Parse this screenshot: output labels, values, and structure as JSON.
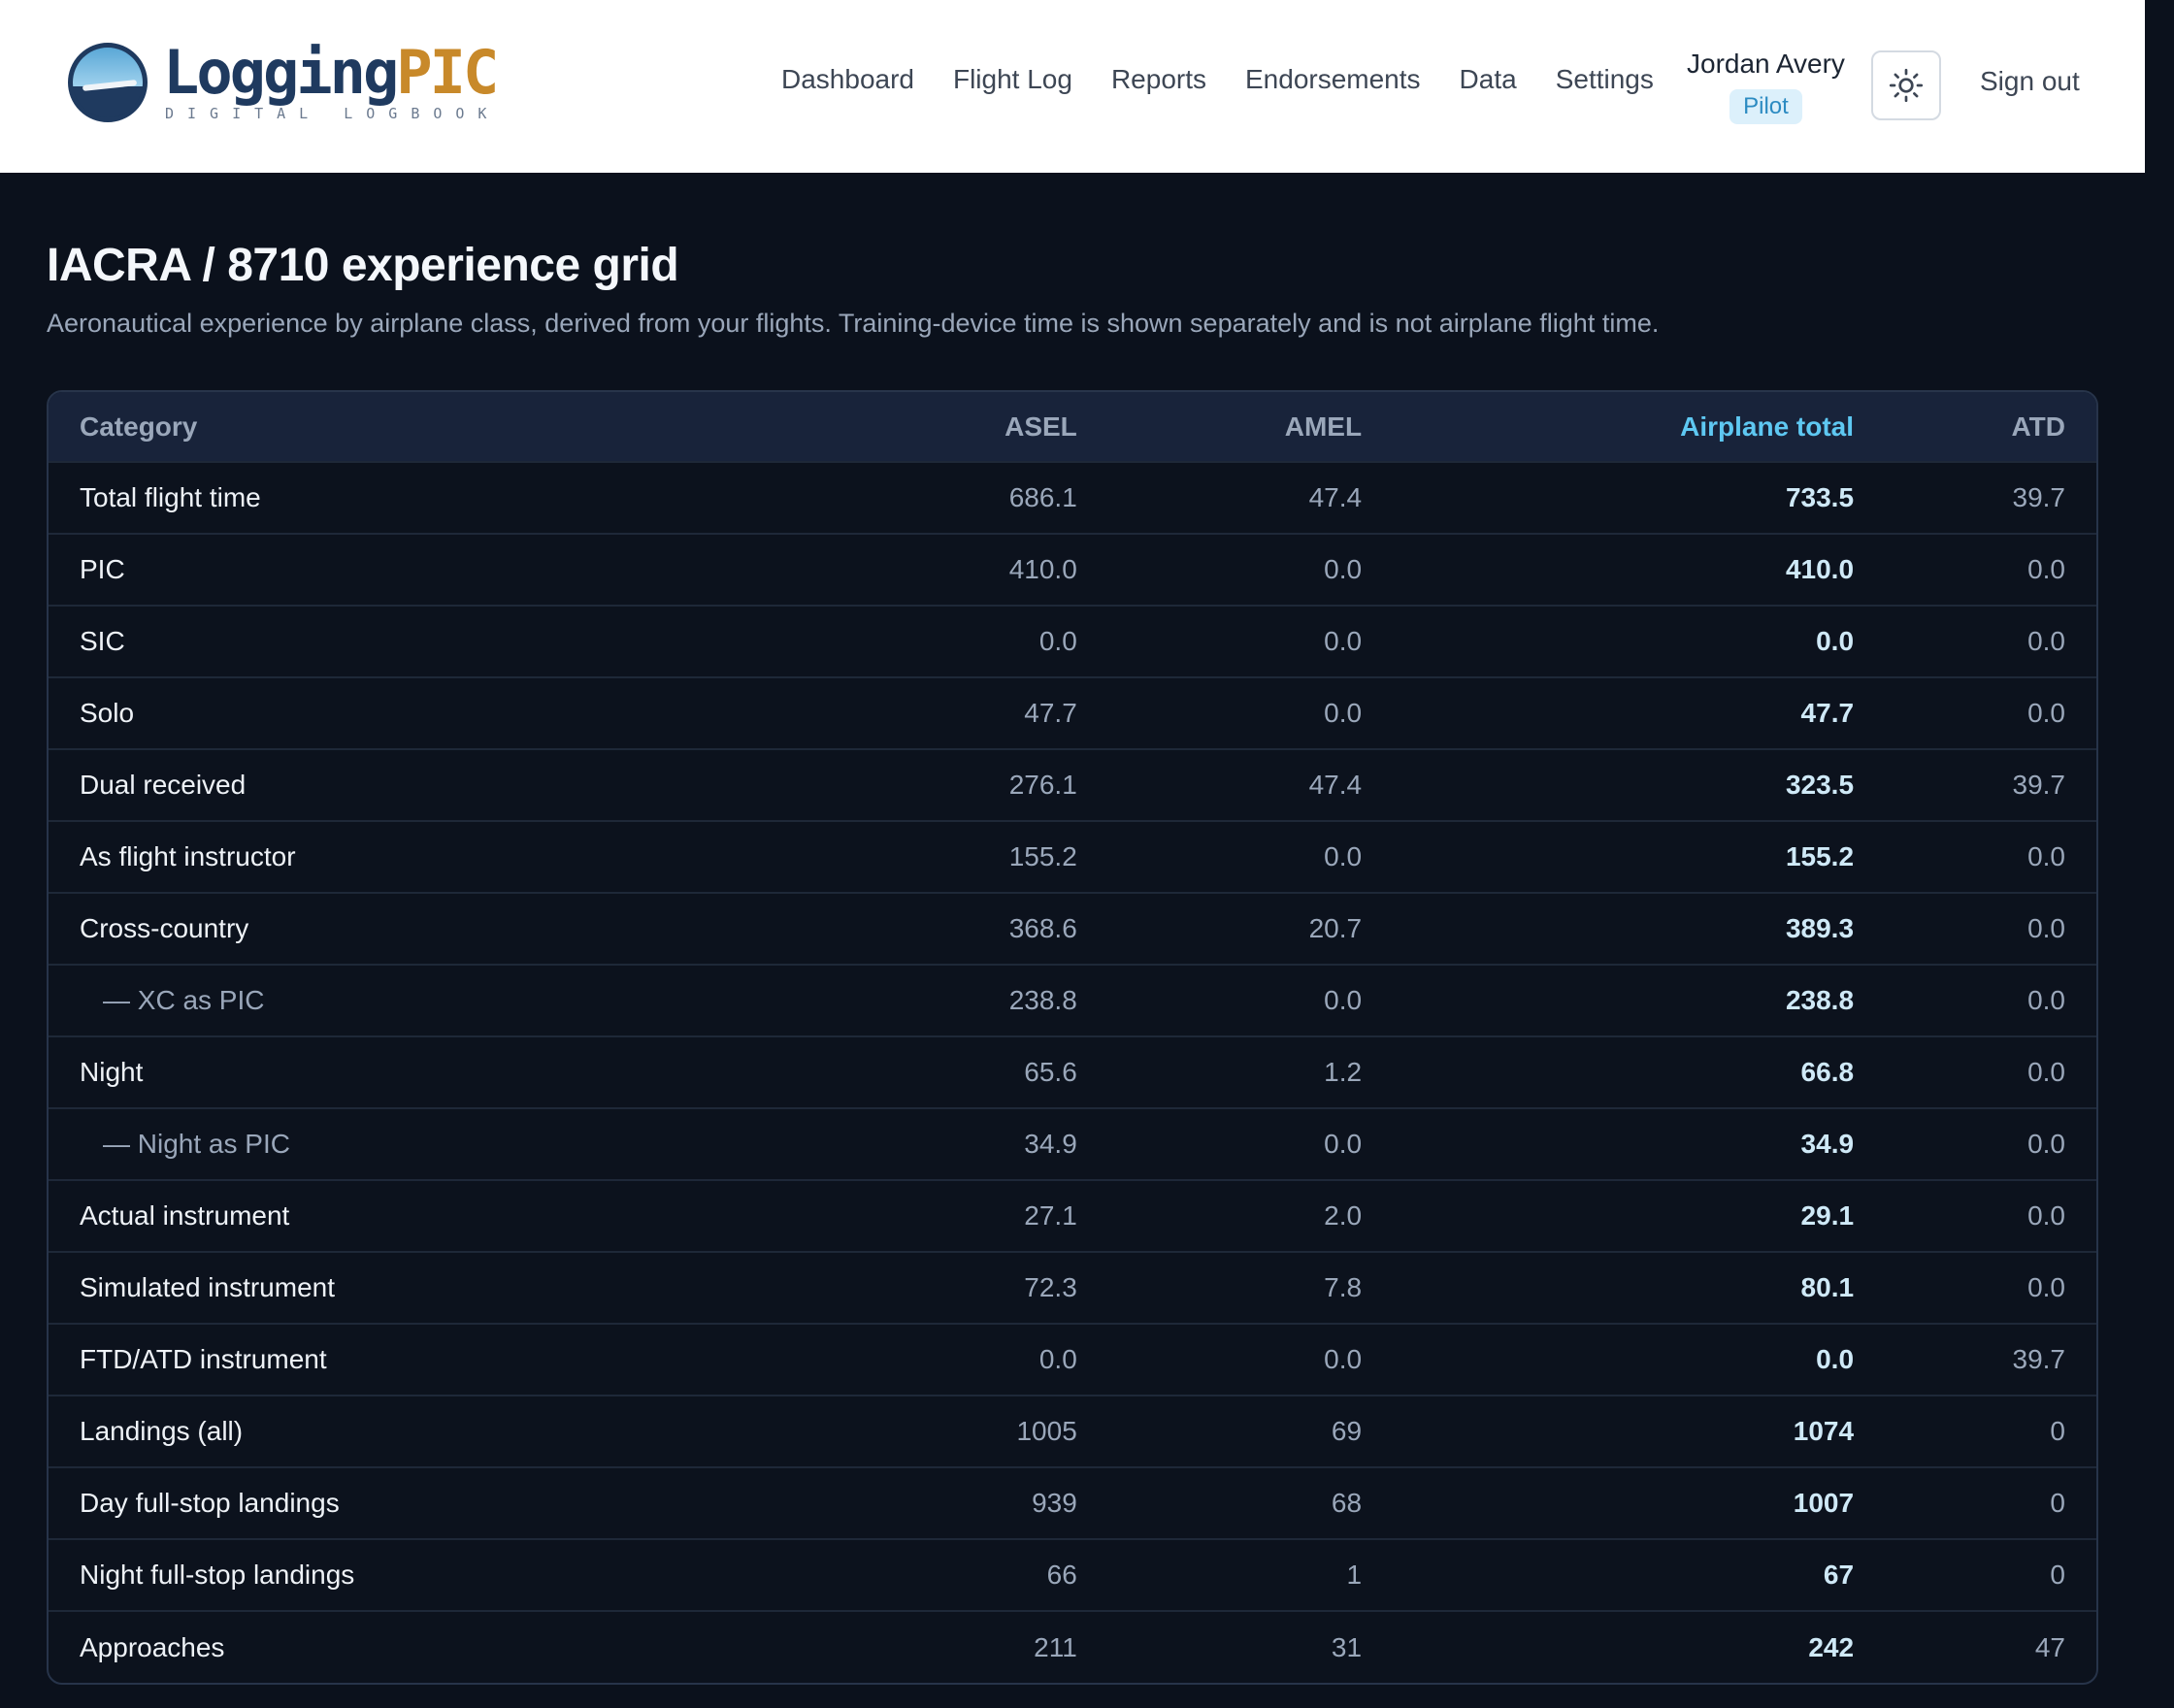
{
  "header": {
    "logo_primary": "Logging",
    "logo_accent": "PIC",
    "logo_tagline": "DIGITAL LOGBOOK",
    "nav": [
      "Dashboard",
      "Flight Log",
      "Reports",
      "Endorsements",
      "Data",
      "Settings"
    ],
    "user_name": "Jordan Avery",
    "user_role": "Pilot",
    "theme_icon": "sun-icon",
    "sign_out": "Sign out"
  },
  "page": {
    "title": "IACRA / 8710 experience grid",
    "subtitle": "Aeronautical experience by airplane class, derived from your flights. Training-device time is shown separately and is not airplane flight time."
  },
  "table": {
    "columns": [
      "Category",
      "ASEL",
      "AMEL",
      "Airplane total",
      "ATD"
    ],
    "rows": [
      {
        "category": "Total flight time",
        "sub": false,
        "asel": "686.1",
        "amel": "47.4",
        "total": "733.5",
        "atd": "39.7"
      },
      {
        "category": "PIC",
        "sub": false,
        "asel": "410.0",
        "amel": "0.0",
        "total": "410.0",
        "atd": "0.0"
      },
      {
        "category": "SIC",
        "sub": false,
        "asel": "0.0",
        "amel": "0.0",
        "total": "0.0",
        "atd": "0.0"
      },
      {
        "category": "Solo",
        "sub": false,
        "asel": "47.7",
        "amel": "0.0",
        "total": "47.7",
        "atd": "0.0"
      },
      {
        "category": "Dual received",
        "sub": false,
        "asel": "276.1",
        "amel": "47.4",
        "total": "323.5",
        "atd": "39.7"
      },
      {
        "category": "As flight instructor",
        "sub": false,
        "asel": "155.2",
        "amel": "0.0",
        "total": "155.2",
        "atd": "0.0"
      },
      {
        "category": "Cross-country",
        "sub": false,
        "asel": "368.6",
        "amel": "20.7",
        "total": "389.3",
        "atd": "0.0"
      },
      {
        "category": "— XC as PIC",
        "sub": true,
        "asel": "238.8",
        "amel": "0.0",
        "total": "238.8",
        "atd": "0.0"
      },
      {
        "category": "Night",
        "sub": false,
        "asel": "65.6",
        "amel": "1.2",
        "total": "66.8",
        "atd": "0.0"
      },
      {
        "category": "— Night as PIC",
        "sub": true,
        "asel": "34.9",
        "amel": "0.0",
        "total": "34.9",
        "atd": "0.0"
      },
      {
        "category": "Actual instrument",
        "sub": false,
        "asel": "27.1",
        "amel": "2.0",
        "total": "29.1",
        "atd": "0.0"
      },
      {
        "category": "Simulated instrument",
        "sub": false,
        "asel": "72.3",
        "amel": "7.8",
        "total": "80.1",
        "atd": "0.0"
      },
      {
        "category": "FTD/ATD instrument",
        "sub": false,
        "asel": "0.0",
        "amel": "0.0",
        "total": "0.0",
        "atd": "39.7"
      },
      {
        "category": "Landings (all)",
        "sub": false,
        "asel": "1005",
        "amel": "69",
        "total": "1074",
        "atd": "0"
      },
      {
        "category": "Day full-stop landings",
        "sub": false,
        "asel": "939",
        "amel": "68",
        "total": "1007",
        "atd": "0"
      },
      {
        "category": "Night full-stop landings",
        "sub": false,
        "asel": "66",
        "amel": "1",
        "total": "67",
        "atd": "0"
      },
      {
        "category": "Approaches",
        "sub": false,
        "asel": "211",
        "amel": "31",
        "total": "242",
        "atd": "47"
      }
    ]
  },
  "colors": {
    "background": "#0b111c",
    "accent": "#5ec8f2",
    "brand_navy": "#1f3a5f",
    "brand_gold": "#c8892a"
  }
}
